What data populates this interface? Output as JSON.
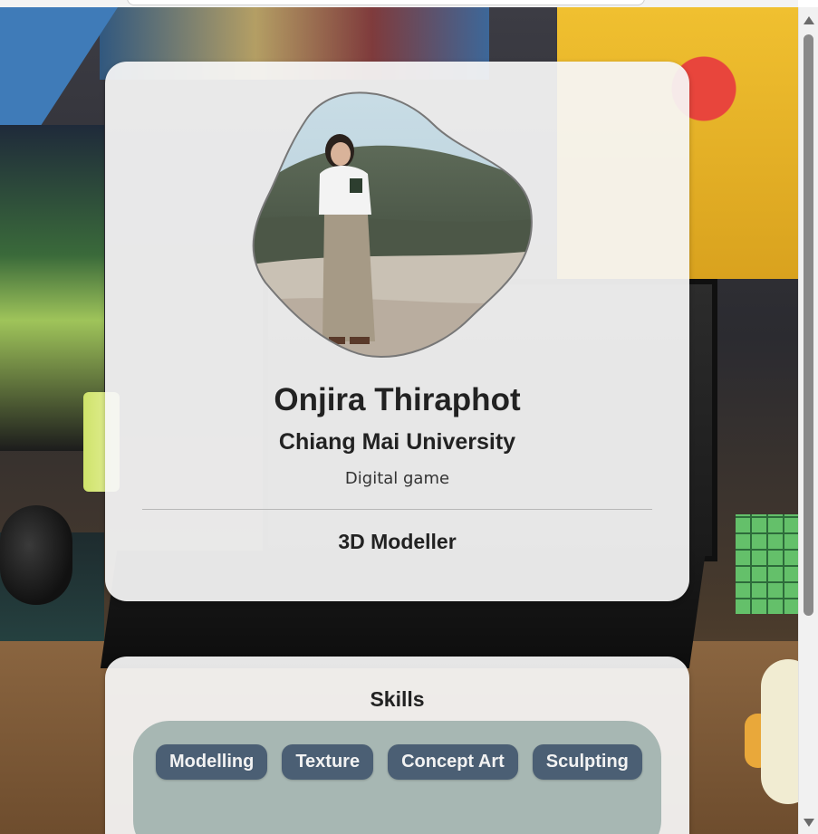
{
  "profile": {
    "name": "Onjira Thiraphot",
    "university": "Chiang Mai University",
    "major": "Digital game",
    "role": "3D Modeller"
  },
  "skills": {
    "title": "Skills",
    "items": [
      "Modelling",
      "Texture",
      "Concept Art",
      "Sculpting"
    ]
  },
  "colors": {
    "card_bg": "#f6f6f6",
    "skills_box_bg": "#a7b7b3",
    "tag_bg": "#4b5f74",
    "tag_text": "#f2f2f2",
    "text": "#222222"
  },
  "icons": {
    "scroll_up": "triangle-up-icon",
    "scroll_down": "triangle-down-icon"
  }
}
